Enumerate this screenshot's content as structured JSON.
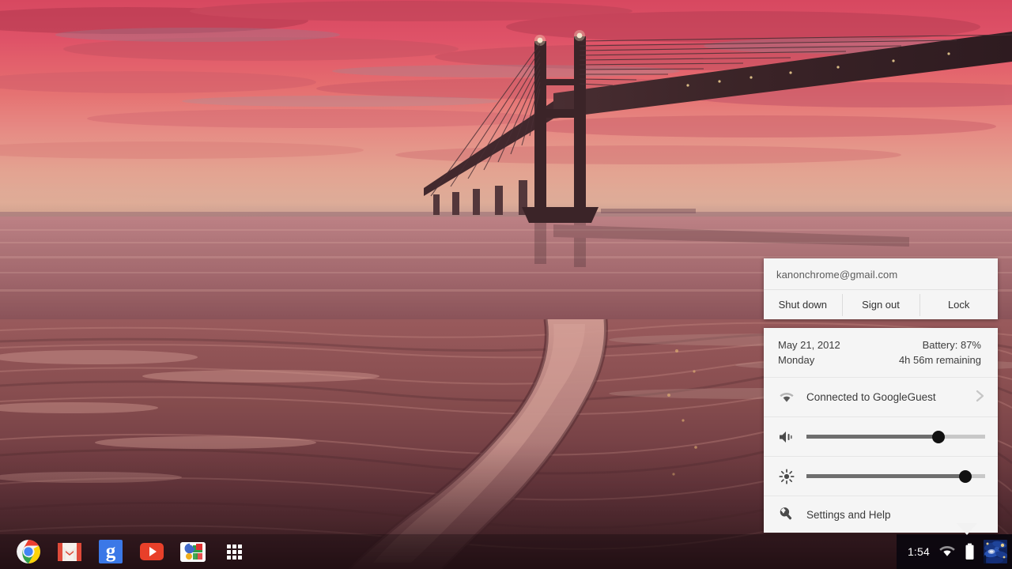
{
  "desktop": {
    "wallpaper_name": "vasco-da-gama-bridge-sunset",
    "wallpaper_colors": {
      "sky_top": "#e8546a",
      "sky_mid": "#f2807f",
      "sky_glow": "#ffd9a0",
      "water": "#b36a6e",
      "sand": "#a05a5c",
      "bridge": "#3a2327",
      "foreground": "#4a2a2e"
    }
  },
  "shelf": {
    "apps": [
      {
        "name": "chrome",
        "label": "Google Chrome",
        "icon": "chrome-icon"
      },
      {
        "name": "gmail",
        "label": "Gmail",
        "icon": "gmail-icon"
      },
      {
        "name": "google-search",
        "label": "Google Search",
        "icon": "google-g-icon"
      },
      {
        "name": "youtube",
        "label": "YouTube",
        "icon": "youtube-icon"
      },
      {
        "name": "google-docs",
        "label": "Google",
        "icon": "google-multicolor-icon"
      },
      {
        "name": "app-launcher",
        "label": "Apps",
        "icon": "grid-icon"
      }
    ]
  },
  "tray": {
    "time": "1:54",
    "network_icon": "wifi-icon",
    "battery_icon": "battery-icon",
    "avatar_label": "user-avatar"
  },
  "panel": {
    "account": {
      "email": "kanonchrome@gmail.com"
    },
    "actions": [
      {
        "id": "shut-down",
        "label": "Shut down"
      },
      {
        "id": "sign-out",
        "label": "Sign out"
      },
      {
        "id": "lock",
        "label": "Lock"
      }
    ],
    "status": {
      "date": "May 21, 2012",
      "day": "Monday",
      "battery": "Battery: 87%",
      "battery_remaining": "4h 56m remaining",
      "battery_percent": 87
    },
    "network": {
      "icon": "wifi-icon",
      "label": "Connected to GoogleGuest",
      "chevron": "chevron-right-icon"
    },
    "volume": {
      "icon": "volume-icon",
      "value": 74
    },
    "brightness": {
      "icon": "brightness-icon",
      "value": 89
    },
    "settings": {
      "icon": "wrench-icon",
      "label": "Settings and Help"
    }
  }
}
